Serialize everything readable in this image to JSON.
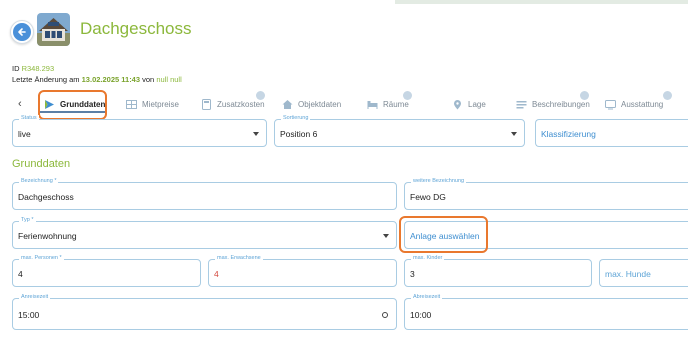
{
  "header": {
    "title": "Dachgeschoss",
    "id_label": "ID",
    "id_value": "R348.293",
    "last_change_label": "Letzte Änderung am",
    "last_change_date": "13.02.2025 11:43",
    "by_label": "von",
    "by_value": "null null"
  },
  "tabs": {
    "left_arrow": "‹",
    "items": [
      {
        "label": "Grunddaten",
        "icon": "pen-icon",
        "active": true
      },
      {
        "label": "Mietpreise",
        "icon": "grid-icon",
        "active": false
      },
      {
        "label": "Zusatzkosten",
        "icon": "calculator-icon",
        "active": false
      },
      {
        "label": "Objektdaten",
        "icon": "house-icon",
        "active": false
      },
      {
        "label": "Räume",
        "icon": "bed-icon",
        "active": false
      },
      {
        "label": "Lage",
        "icon": "location-pin-icon",
        "active": false
      },
      {
        "label": "Beschreibungen",
        "icon": "text-lines-icon",
        "active": false
      },
      {
        "label": "Ausstattung",
        "icon": "tv-icon",
        "active": false
      }
    ]
  },
  "top_fields": {
    "status": {
      "label": "Status",
      "value": "live"
    },
    "sortierung": {
      "label": "Sortierung",
      "value": "Position 6"
    },
    "klassifizierung": {
      "placeholder": "Klassifizierung"
    }
  },
  "section": {
    "title": "Grunddaten"
  },
  "form": {
    "bezeichnung": {
      "label": "Bezeichnung *",
      "value": "Dachgeschoss"
    },
    "weitere_bezeichnung": {
      "label": "weitere Bezeichnung",
      "value": "Fewo DG"
    },
    "typ": {
      "label": "Typ *",
      "value": "Ferienwohnung"
    },
    "anlage": {
      "placeholder": "Anlage auswählen"
    },
    "max_personen": {
      "label": "max. Personen *",
      "value": "4"
    },
    "max_erwachsene": {
      "label": "max. Erwachsene",
      "value": "4"
    },
    "max_kinder": {
      "label": "max. Kinder",
      "value": "3"
    },
    "max_hunde": {
      "placeholder": "max. Hunde"
    },
    "anreisezeit": {
      "label": "Anreisezeit",
      "value": "15:00"
    },
    "abreisezeit": {
      "label": "Abreisezeit",
      "value": "10:00"
    }
  },
  "colors": {
    "accent_green": "#8cb83c",
    "field_border": "#a9cce3",
    "highlight_orange": "#e9782e",
    "link_blue": "#3e8ed0",
    "error_red": "#d34a3f"
  }
}
